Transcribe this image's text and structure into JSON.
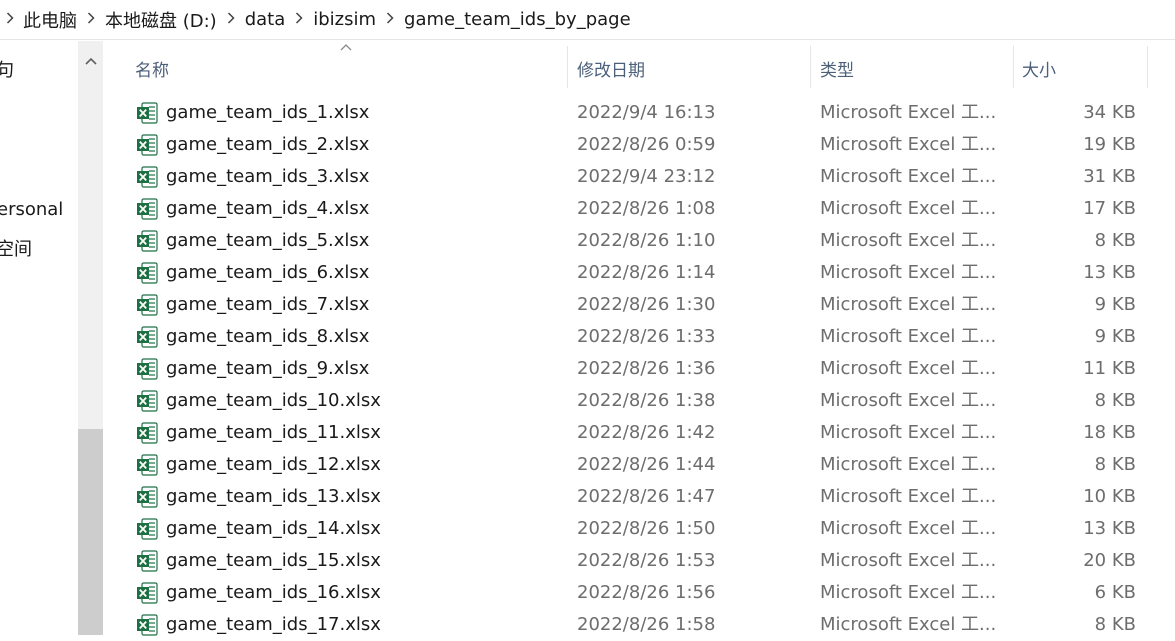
{
  "breadcrumb": {
    "items": [
      "此电脑",
      "本地磁盘 (D:)",
      "data",
      "ibizsim",
      "game_team_ids_by_page"
    ]
  },
  "nav": {
    "items": [
      "句",
      "ersonal",
      "空间"
    ]
  },
  "columns": {
    "name": "名称",
    "date": "修改日期",
    "type": "类型",
    "size": "大小"
  },
  "files": [
    {
      "name": "game_team_ids_1.xlsx",
      "date": "2022/9/4 16:13",
      "type": "Microsoft Excel 工...",
      "size": "34 KB"
    },
    {
      "name": "game_team_ids_2.xlsx",
      "date": "2022/8/26 0:59",
      "type": "Microsoft Excel 工...",
      "size": "19 KB"
    },
    {
      "name": "game_team_ids_3.xlsx",
      "date": "2022/9/4 23:12",
      "type": "Microsoft Excel 工...",
      "size": "31 KB"
    },
    {
      "name": "game_team_ids_4.xlsx",
      "date": "2022/8/26 1:08",
      "type": "Microsoft Excel 工...",
      "size": "17 KB"
    },
    {
      "name": "game_team_ids_5.xlsx",
      "date": "2022/8/26 1:10",
      "type": "Microsoft Excel 工...",
      "size": "8 KB"
    },
    {
      "name": "game_team_ids_6.xlsx",
      "date": "2022/8/26 1:14",
      "type": "Microsoft Excel 工...",
      "size": "13 KB"
    },
    {
      "name": "game_team_ids_7.xlsx",
      "date": "2022/8/26 1:30",
      "type": "Microsoft Excel 工...",
      "size": "9 KB"
    },
    {
      "name": "game_team_ids_8.xlsx",
      "date": "2022/8/26 1:33",
      "type": "Microsoft Excel 工...",
      "size": "9 KB"
    },
    {
      "name": "game_team_ids_9.xlsx",
      "date": "2022/8/26 1:36",
      "type": "Microsoft Excel 工...",
      "size": "11 KB"
    },
    {
      "name": "game_team_ids_10.xlsx",
      "date": "2022/8/26 1:38",
      "type": "Microsoft Excel 工...",
      "size": "8 KB"
    },
    {
      "name": "game_team_ids_11.xlsx",
      "date": "2022/8/26 1:42",
      "type": "Microsoft Excel 工...",
      "size": "18 KB"
    },
    {
      "name": "game_team_ids_12.xlsx",
      "date": "2022/8/26 1:44",
      "type": "Microsoft Excel 工...",
      "size": "8 KB"
    },
    {
      "name": "game_team_ids_13.xlsx",
      "date": "2022/8/26 1:47",
      "type": "Microsoft Excel 工...",
      "size": "10 KB"
    },
    {
      "name": "game_team_ids_14.xlsx",
      "date": "2022/8/26 1:50",
      "type": "Microsoft Excel 工...",
      "size": "13 KB"
    },
    {
      "name": "game_team_ids_15.xlsx",
      "date": "2022/8/26 1:53",
      "type": "Microsoft Excel 工...",
      "size": "20 KB"
    },
    {
      "name": "game_team_ids_16.xlsx",
      "date": "2022/8/26 1:56",
      "type": "Microsoft Excel 工...",
      "size": "6 KB"
    },
    {
      "name": "game_team_ids_17.xlsx",
      "date": "2022/8/26 1:58",
      "type": "Microsoft Excel 工...",
      "size": "8 KB"
    }
  ],
  "icons": {
    "file": "excel-file-icon",
    "sort": "sort-ascending-icon",
    "scroll_up": "scroll-up-icon",
    "separator": "chevron-right-icon"
  },
  "colors": {
    "excel_green": "#1d7044",
    "header_text": "#4c607a"
  }
}
